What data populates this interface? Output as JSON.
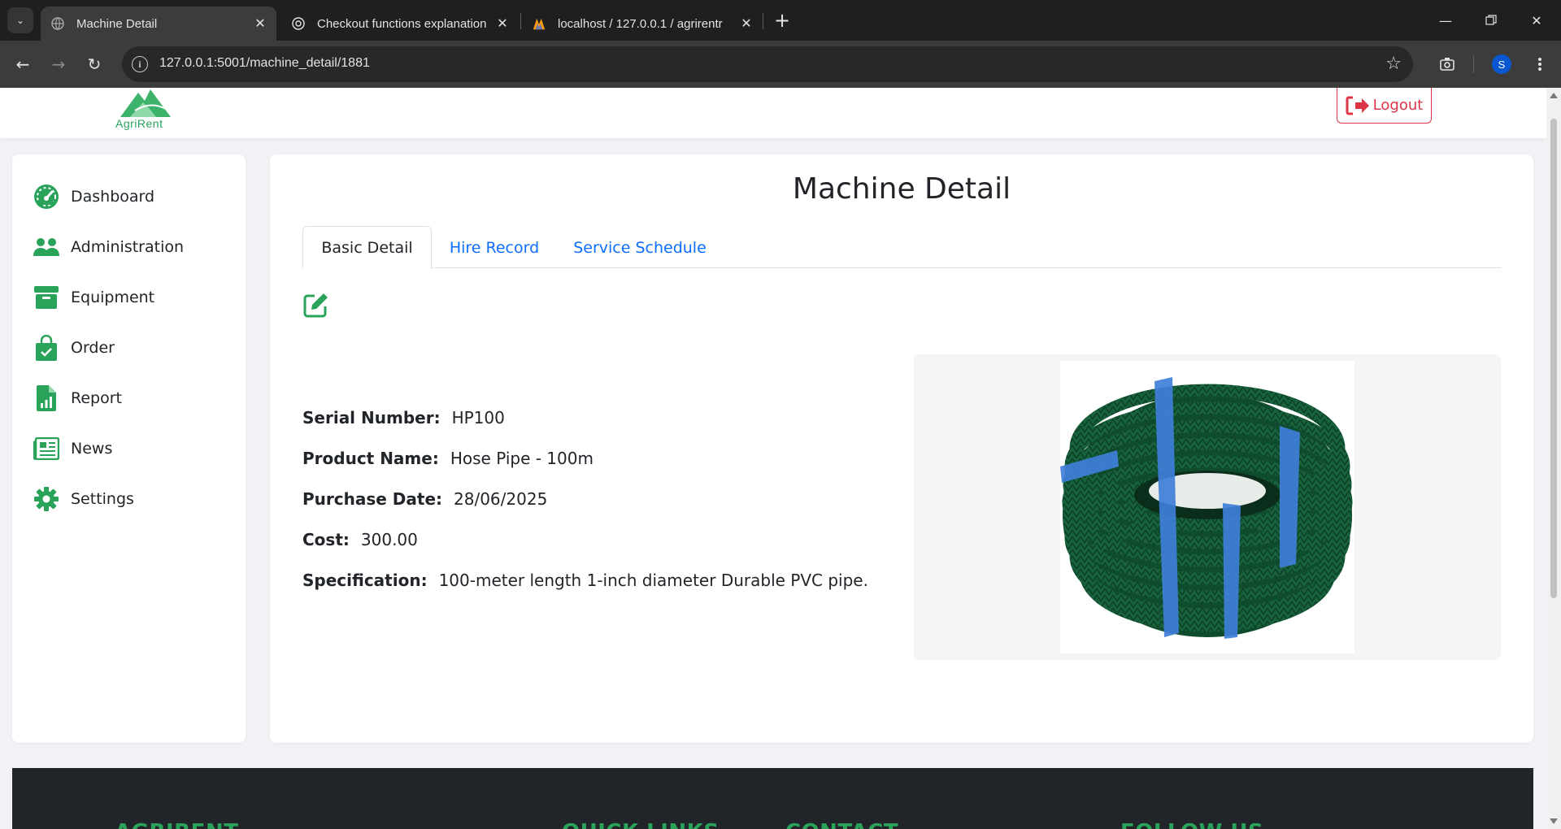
{
  "browser": {
    "tabs": [
      {
        "title": "Machine Detail",
        "active": true
      },
      {
        "title": "Checkout functions explanation",
        "active": false
      },
      {
        "title": "localhost / 127.0.0.1 / agrirentr",
        "active": false
      }
    ],
    "url": "127.0.0.1:5001/machine_detail/1881",
    "profile_initial": "S"
  },
  "header": {
    "logo_text": "AgriRent",
    "logout_label": "Logout"
  },
  "sidebar": {
    "items": [
      {
        "label": "Dashboard",
        "icon": "gauge-icon"
      },
      {
        "label": "Administration",
        "icon": "users-icon"
      },
      {
        "label": "Equipment",
        "icon": "archive-box-icon"
      },
      {
        "label": "Order",
        "icon": "shopping-bag-check-icon"
      },
      {
        "label": "Report",
        "icon": "file-chart-icon"
      },
      {
        "label": "News",
        "icon": "newspaper-icon"
      },
      {
        "label": "Settings",
        "icon": "gear-icon"
      }
    ]
  },
  "main": {
    "title": "Machine Detail",
    "tabs": [
      {
        "label": "Basic Detail",
        "active": true
      },
      {
        "label": "Hire Record",
        "active": false
      },
      {
        "label": "Service Schedule",
        "active": false
      }
    ],
    "details": {
      "serial_label": "Serial Number:",
      "serial_value": "HP100",
      "name_label": "Product Name:",
      "name_value": "Hose Pipe - 100m",
      "date_label": "Purchase Date:",
      "date_value": "28/06/2025",
      "cost_label": "Cost:",
      "cost_value": "300.00",
      "spec_label": "Specification:",
      "spec_value": "100-meter length 1-inch diameter Durable PVC pipe."
    }
  },
  "footer": {
    "headings": [
      "AGRIRENT",
      "QUICK LINKS",
      "CONTACT",
      "FOLLOW US"
    ]
  },
  "colors": {
    "brand_green": "#29a35a",
    "link_blue": "#0d6efd",
    "danger_red": "#dc3545"
  }
}
